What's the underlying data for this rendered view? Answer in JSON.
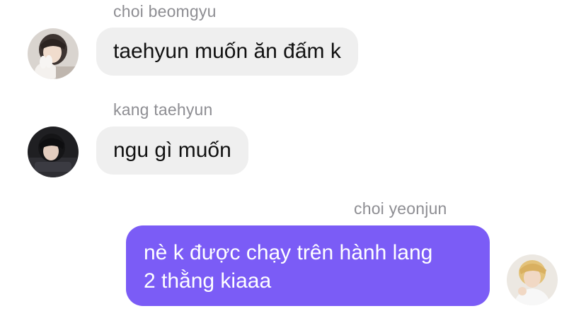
{
  "messages": [
    {
      "sender": "choi beomgyu",
      "text": "taehyun muốn ăn đấm k",
      "avatar_icon": "user-avatar-icon"
    },
    {
      "sender": "kang taehyun",
      "text": "ngu gì muốn",
      "avatar_icon": "user-avatar-icon"
    },
    {
      "sender": "choi yeonjun",
      "lines": [
        "nè k được chạy trên hành lang",
        "2 thằng kiaaa"
      ],
      "avatar_icon": "user-avatar-icon"
    }
  ],
  "colors": {
    "incoming_bubble": "#efefef",
    "outgoing_bubble": "#7b5cf6",
    "sender_name": "#8e8e93"
  }
}
